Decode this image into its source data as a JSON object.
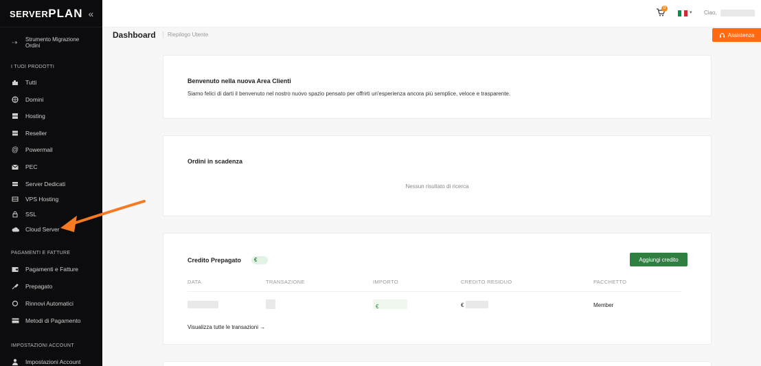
{
  "brand": {
    "logo_small": "SERVER",
    "logo_big": "PLAN",
    "collapse": "«"
  },
  "sidebar": {
    "migration_label": "Strumento Migrazione Ordini",
    "sections": [
      {
        "title": "I TUOI PRODOTTI"
      },
      {
        "title": "PAGAMENTI E FATTURE"
      },
      {
        "title": "IMPOSTAZIONI ACCOUNT"
      }
    ],
    "products": [
      {
        "label": "Tutti",
        "icon": "puzzle-icon"
      },
      {
        "label": "Domini",
        "icon": "globe-icon"
      },
      {
        "label": "Hosting",
        "icon": "server-icon"
      },
      {
        "label": "Reseller",
        "icon": "reseller-icon"
      },
      {
        "label": "Powermail",
        "icon": "at-icon"
      },
      {
        "label": "PEC",
        "icon": "mail-icon"
      },
      {
        "label": "Server Dedicati",
        "icon": "dedicated-server-icon"
      },
      {
        "label": "VPS Hosting",
        "icon": "vps-icon"
      },
      {
        "label": "SSL",
        "icon": "lock-icon"
      },
      {
        "label": "Cloud Server",
        "icon": "cloud-icon"
      }
    ],
    "payments": [
      {
        "label": "Pagamenti e Fatture",
        "icon": "invoice-icon"
      },
      {
        "label": "Prepagato",
        "icon": "prepaid-icon"
      },
      {
        "label": "Rinnovi Automatici",
        "icon": "renew-icon"
      },
      {
        "label": "Metodi di Pagamento",
        "icon": "card-icon"
      }
    ],
    "account": [
      {
        "label": "Impostazioni Account",
        "icon": "user-icon"
      }
    ]
  },
  "topbar": {
    "cart_count": "0",
    "language_flag_colors": [
      "#009246",
      "#ffffff",
      "#ce2b37"
    ],
    "greeting": "Ciao,"
  },
  "header": {
    "title": "Dashboard",
    "subtitle": "Riepilogo Utente",
    "assist_label": "Assistenza"
  },
  "welcome": {
    "title": "Benvenuto nella nuova Area Clienti",
    "text": "Siamo felici di darti il benvenuto nel nostro nuovo spazio pensato per offrirti un'esperienza ancora più semplice, veloce e trasparente."
  },
  "orders": {
    "title": "Ordini in scadenza",
    "empty": "Nessun risultato di ricerca"
  },
  "credit": {
    "title": "Credito Prepagato",
    "pill": "€",
    "add_button": "Aggiungi credito",
    "columns": [
      "DATA",
      "TRANSAZIONE",
      "IMPORTO",
      "CREDITO RESIDUO",
      "PACCHETTO"
    ],
    "row": {
      "importo_prefix": "€",
      "credito_prefix": "€",
      "pacchetto": "Member"
    },
    "see_all": "Visualizza tutte le transazioni →"
  },
  "colors": {
    "accent_orange": "#ff6a13",
    "button_green": "#2f8040",
    "sidebar_bg": "#0c0c0e"
  }
}
